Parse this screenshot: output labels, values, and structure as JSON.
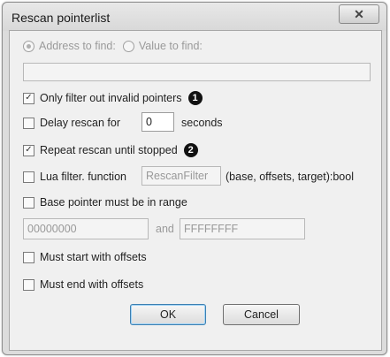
{
  "window": {
    "title": "Rescan pointerlist",
    "close_glyph": "✕"
  },
  "radios": {
    "address_label": "Address to find:",
    "value_label": "Value to find:"
  },
  "address_field": {
    "value": ""
  },
  "options": {
    "only_filter_label": "Only filter out invalid pointers",
    "only_filter_checked": true,
    "badge1": "1",
    "delay_label": "Delay rescan for",
    "delay_checked": false,
    "delay_value": "0",
    "delay_unit": "seconds",
    "repeat_label": "Repeat rescan until stopped",
    "repeat_checked": true,
    "badge2": "2",
    "lua_label": "Lua filter. function",
    "lua_checked": false,
    "lua_placeholder": "RescanFilter",
    "lua_signature": "(base, offsets, target):bool",
    "range_label": "Base pointer must be in range",
    "range_checked": false,
    "range_from": "00000000",
    "range_and": "and",
    "range_to": "FFFFFFFF",
    "start_label": "Must start with offsets",
    "start_checked": false,
    "end_label": "Must end with offsets",
    "end_checked": false
  },
  "buttons": {
    "ok_label": "OK",
    "cancel_label": "Cancel"
  }
}
